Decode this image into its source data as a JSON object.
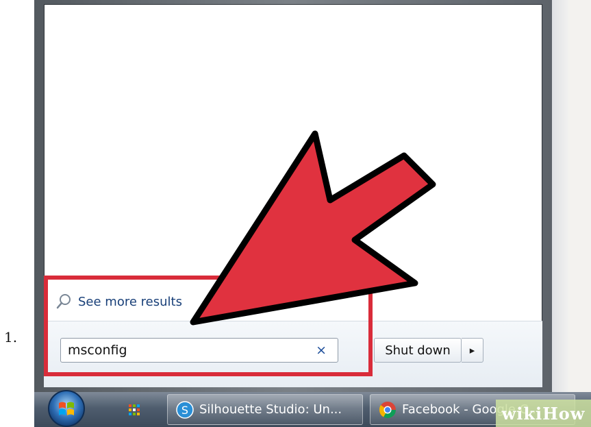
{
  "list_marker": "1.",
  "start_menu": {
    "see_more_label": "See more results",
    "search": {
      "value": "msconfig",
      "clear_glyph": "×"
    },
    "shutdown_label": "Shut down",
    "shutdown_arrow_glyph": "▸"
  },
  "taskbar": {
    "items": [
      {
        "label": "Silhouette Studio: Un...",
        "icon": "silhouette-studio-icon"
      },
      {
        "label": "Facebook - Google C...",
        "icon": "chrome-icon"
      }
    ]
  },
  "watermark": "wikiHow",
  "colors": {
    "highlight": "#d92c3a",
    "arrow": "#e0323f",
    "link": "#183f78"
  }
}
